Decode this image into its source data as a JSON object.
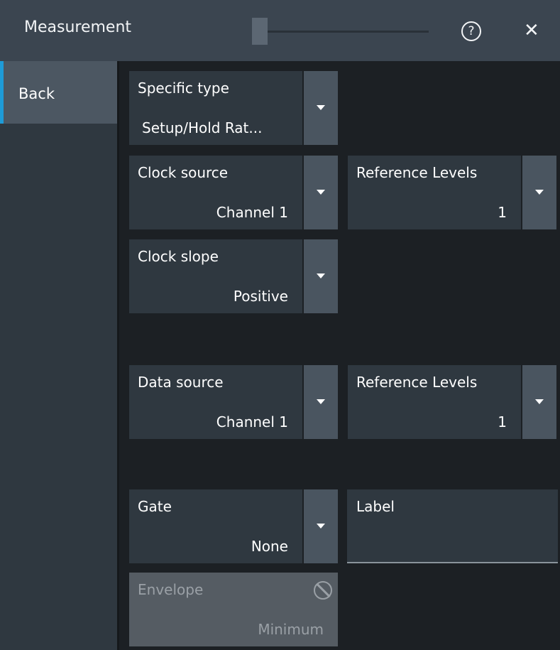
{
  "window": {
    "title": "Measurement",
    "help_glyph": "?",
    "close_glyph": "✕"
  },
  "sidebar": {
    "back_label": "Back"
  },
  "fields": {
    "specific_type": {
      "label": "Specific type",
      "value": "Setup/Hold Rat..."
    },
    "clock_source": {
      "label": "Clock source",
      "value": "Channel 1"
    },
    "clock_ref_levels": {
      "label": "Reference Levels",
      "value": "1"
    },
    "clock_slope": {
      "label": "Clock slope",
      "value": "Positive"
    },
    "data_source": {
      "label": "Data source",
      "value": "Channel 1"
    },
    "data_ref_levels": {
      "label": "Reference Levels",
      "value": "1"
    },
    "gate": {
      "label": "Gate",
      "value": "None"
    },
    "label": {
      "label": "Label",
      "value": ""
    },
    "envelope": {
      "label": "Envelope",
      "value": "Minimum",
      "disabled": true
    }
  },
  "icons": {
    "help": "help-icon",
    "close": "close-icon",
    "dropdown": "chevron-down-icon",
    "disabled": "blocked-icon"
  },
  "colors": {
    "accent": "#1e9bd7",
    "titlebar": "#3b4550",
    "panel": "#2f3840",
    "dropdown_button": "#4a5560",
    "disabled_panel": "#555c63",
    "background": "#1c2024"
  }
}
